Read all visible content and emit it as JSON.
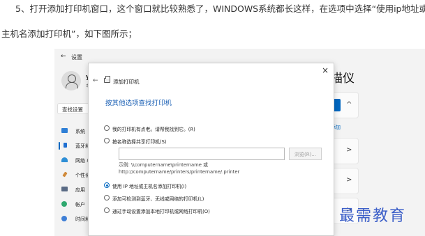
{
  "article": {
    "line1": "5、打开添加打印机窗口，这个窗口就比较熟悉了，WINDOWS系统都长这样，在选项中选择“使用ip地址或",
    "line2": "主机名添加打印机”，如下图所示；"
  },
  "settings": {
    "back_glyph": "←",
    "title": "设置",
    "user_name": "ye",
    "user_sub": "本",
    "search_placeholder": "查找设置",
    "nav": [
      {
        "label": "系统",
        "icon": "monitor-icon",
        "color": "#2f7fd6"
      },
      {
        "label": "蓝牙和",
        "icon": "bluetooth-icon",
        "color": "#1f6fd1",
        "active": true
      },
      {
        "label": "网络 &",
        "icon": "wifi-icon",
        "color": "#2f8fd6"
      },
      {
        "label": "个性化",
        "icon": "brush-icon",
        "color": "#d08a3a"
      },
      {
        "label": "应用",
        "icon": "apps-icon",
        "color": "#5a6b85"
      },
      {
        "label": "帐户",
        "icon": "account-icon",
        "color": "#2fa86f"
      },
      {
        "label": "时间和",
        "icon": "clock-icon",
        "color": "#3f7fd6"
      }
    ],
    "heading_fragment": "描仪",
    "add_link_fragment": "添加",
    "chevron_up": "^",
    "chevron_right": ">",
    "accent": "#0067c0"
  },
  "dialog": {
    "close_glyph": "×",
    "back_glyph": "←",
    "title": "添加打印机",
    "heading": "按其他选项查找打印机",
    "options": [
      {
        "label": "我的打印机有点老。请帮我找到它。(R)",
        "checked": false
      },
      {
        "label": "按名称选择共享打印机(S)",
        "checked": false
      }
    ],
    "share_input_value": "",
    "browse_label": "浏览(R)...",
    "example_line1": "示例: \\\\computername\\printername 或",
    "example_line2": "http://computername/printers/printername/.printer",
    "options2": [
      {
        "label": "使用 IP 地址或主机名添加打印机(I)",
        "checked": true
      },
      {
        "label": "添加可检测到蓝牙、无线或网络的打印机(L)",
        "checked": false
      },
      {
        "label": "通过手动设置添加本地打印机或网络打印机(O)",
        "checked": false
      }
    ]
  },
  "watermark": "最需教育"
}
